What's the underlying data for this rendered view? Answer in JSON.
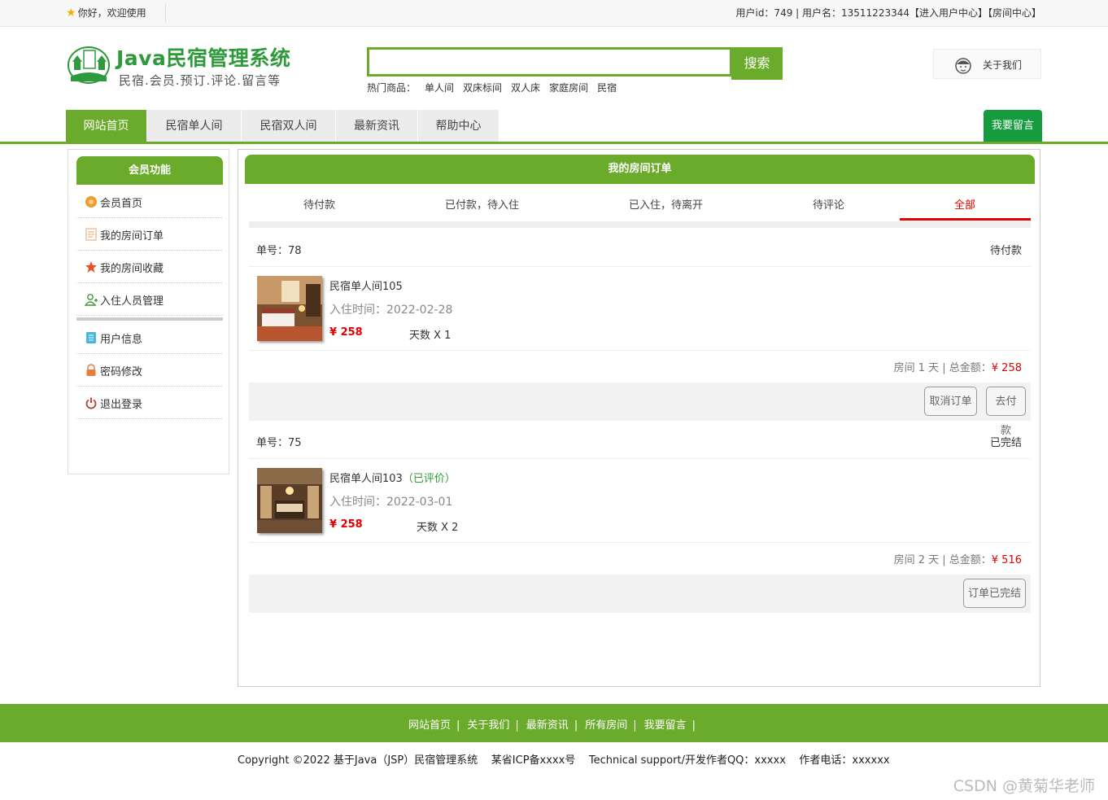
{
  "topbar": {
    "welcome": "你好，欢迎使用",
    "user_info": "用户id：749 | 用户名：13511223344【进入用户中心】【房间中心】"
  },
  "header": {
    "logo_title": "Java民宿管理系统",
    "logo_subtitle": "民宿.会员.预订.评论.留言等",
    "search_placeholder": "",
    "search_button": "搜索",
    "hot_label": "热门商品：",
    "hot_items": [
      "单人间",
      "双床标间",
      "双人床",
      "家庭房间",
      "民宿"
    ],
    "about_label": "关于我们"
  },
  "nav": {
    "items": [
      "网站首页",
      "民宿单人间",
      "民宿双人间",
      "最新资讯",
      "帮助中心"
    ],
    "leave_message": "我要留言"
  },
  "sidebar": {
    "title": "会员功能",
    "items": [
      "会员首页",
      "我的房间订单",
      "我的房间收藏",
      "入住人员管理",
      "用户信息",
      "密码修改",
      "退出登录"
    ]
  },
  "main": {
    "title": "我的房间订单",
    "tabs": [
      "待付款",
      "已付款，待入住",
      "已入住，待离开",
      "待评论",
      "全部"
    ],
    "active_tab": "全部",
    "orders": [
      {
        "number_text": "单号：78",
        "status": "待付款",
        "room_name": "民宿单人间105",
        "rated": "",
        "checkin": "入住时间：2022-02-28",
        "price": "¥ 258",
        "days": "天数 X 1",
        "summary": "房间 1 天 | 总金额：",
        "total": "¥ 258",
        "buttons": [
          "取消订单",
          "去付款"
        ]
      },
      {
        "number_text": "单号：75",
        "status": "已完结",
        "room_name": "民宿单人间103",
        "rated": "（已评价）",
        "checkin": "入住时间：2022-03-01",
        "price": "¥ 258",
        "days": "天数 X 2",
        "summary": "房间 2 天 | 总金额：",
        "total": "¥ 516",
        "buttons": [
          "订单已完结"
        ]
      }
    ]
  },
  "footer": {
    "links": [
      "网站首页",
      "关于我们",
      "最新资讯",
      "所有房间",
      "我要留言"
    ],
    "separator": "|",
    "copyright": "Copyright ©2022 基于Java（JSP）民宿管理系统    某省ICP备xxxx号    Technical support/开发作者QQ：xxxxx    作者电话：xxxxxx"
  },
  "watermark": "CSDN @黄菊华老师",
  "colors": {
    "brand_green": "#6aab2b",
    "dark_green": "#169c3f",
    "price_red": "#e40000"
  }
}
